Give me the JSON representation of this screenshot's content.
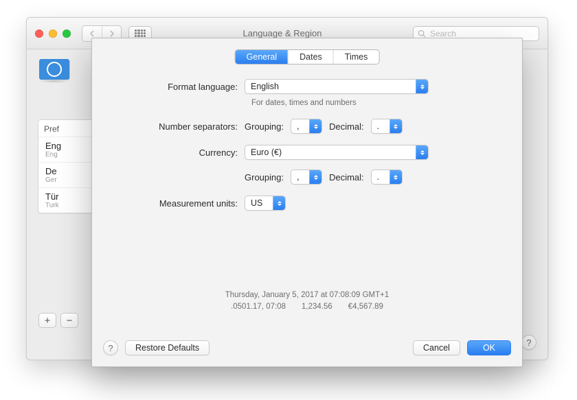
{
  "window": {
    "title": "Language & Region",
    "search_placeholder": "Search"
  },
  "sidebar": {
    "preferred_heading": "Pref",
    "languages": [
      {
        "name": "Eng",
        "sub": "Eng"
      },
      {
        "name": "De",
        "sub": "Ger"
      },
      {
        "name": "Tür",
        "sub": "Turk"
      }
    ],
    "add_label": "+",
    "remove_label": "−"
  },
  "sheet": {
    "tabs": {
      "general": "General",
      "dates": "Dates",
      "times": "Times",
      "active": "general"
    },
    "format_language": {
      "label": "Format language:",
      "value": "English",
      "hint": "For dates, times and numbers"
    },
    "number_separators": {
      "label": "Number separators:",
      "grouping_label": "Grouping:",
      "grouping_value": ",",
      "decimal_label": "Decimal:",
      "decimal_value": "."
    },
    "currency": {
      "label": "Currency:",
      "value": "Euro (€)",
      "grouping_label": "Grouping:",
      "grouping_value": ",",
      "decimal_label": "Decimal:",
      "decimal_value": "."
    },
    "measurement": {
      "label": "Measurement units:",
      "value": "US"
    },
    "preview": {
      "line1": "Thursday, January 5, 2017 at 07:08:09 GMT+1",
      "line2": ".0501.17, 07:08  1,234.56  €4,567.89"
    },
    "buttons": {
      "restore": "Restore Defaults",
      "cancel": "Cancel",
      "ok": "OK"
    }
  },
  "icons": {
    "back": "‹",
    "fwd": "›",
    "help": "?"
  }
}
